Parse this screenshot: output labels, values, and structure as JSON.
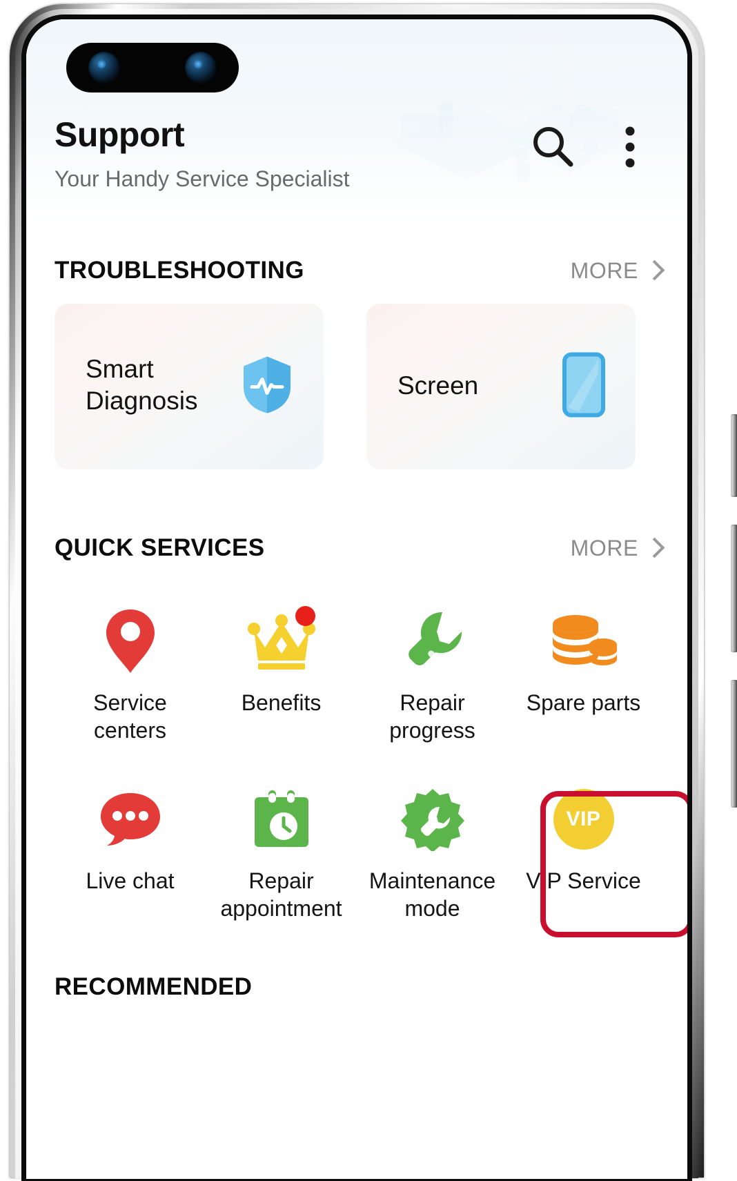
{
  "app": {
    "title": "Support",
    "subtitle": "Your Handy Service Specialist"
  },
  "header": {
    "search_icon": "search-icon",
    "overflow_icon": "more-vertical-icon"
  },
  "sections": {
    "troubleshooting": {
      "title": "TROUBLESHOOTING",
      "more_label": "MORE",
      "cards": [
        {
          "label": "Smart\nDiagnosis",
          "label_line1": "Smart",
          "label_line2": "Diagnosis",
          "icon": "shield-pulse-icon",
          "icon_color": "#57b9ed"
        },
        {
          "label": "Screen",
          "label_line1": "Screen",
          "label_line2": "",
          "icon": "phone-screen-icon",
          "icon_color": "#4fb3e8"
        }
      ]
    },
    "quick_services": {
      "title": "QUICK SERVICES",
      "more_label": "MORE",
      "items": [
        {
          "label_line1": "Service",
          "label_line2": "centers",
          "icon": "location-pin-icon",
          "icon_color": "#e33b38",
          "badge": false,
          "highlighted": false
        },
        {
          "label_line1": "Benefits",
          "label_line2": "",
          "icon": "crown-icon",
          "icon_color": "#f5d02e",
          "badge": true,
          "highlighted": false
        },
        {
          "label_line1": "Repair",
          "label_line2": "progress",
          "icon": "wrench-icon",
          "icon_color": "#5cb54a",
          "badge": false,
          "highlighted": false
        },
        {
          "label_line1": "Spare parts",
          "label_line2": "",
          "icon": "coin-stack-icon",
          "icon_color": "#f28b1e",
          "badge": false,
          "highlighted": false
        },
        {
          "label_line1": "Live chat",
          "label_line2": "",
          "icon": "chat-bubble-icon",
          "icon_color": "#e33b38",
          "badge": false,
          "highlighted": false
        },
        {
          "label_line1": "Repair",
          "label_line2": "appointment",
          "icon": "calendar-clock-icon",
          "icon_color": "#5cb54a",
          "badge": false,
          "highlighted": false
        },
        {
          "label_line1": "Maintenance",
          "label_line2": "mode",
          "icon": "gear-wrench-icon",
          "icon_color": "#5cb54a",
          "badge": false,
          "highlighted": false
        },
        {
          "label_line1": "VIP Service",
          "label_line2": "",
          "icon": "vip-badge-icon",
          "icon_color": "#f2ce33",
          "badge": false,
          "highlighted": true,
          "icon_text": "VIP"
        }
      ]
    },
    "recommended": {
      "title": "RECOMMENDED"
    }
  },
  "colors": {
    "highlight_border": "#c8102e",
    "accent_blue": "#4fb3e8",
    "accent_green": "#5cb54a",
    "accent_red": "#e33b38",
    "accent_orange": "#f28b1e",
    "accent_yellow": "#f2ce33",
    "badge_red": "#e8201c"
  }
}
